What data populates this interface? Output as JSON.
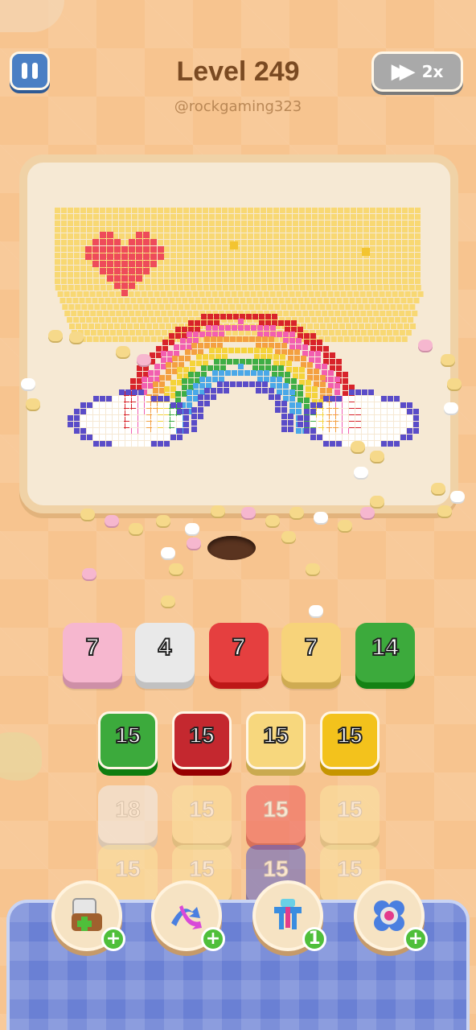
{
  "header": {
    "level_label": "Level 249",
    "username": "@rockgaming323",
    "speed_label": "2x"
  },
  "color_queue": [
    {
      "count": "7",
      "color": "#f6b7cf"
    },
    {
      "count": "4",
      "color": "#e9e9e9"
    },
    {
      "count": "7",
      "color": "#e53f3f"
    },
    {
      "count": "7",
      "color": "#f7d37a"
    },
    {
      "count": "14",
      "color": "#3caa3c"
    }
  ],
  "tile_grid": [
    [
      {
        "count": "15",
        "color": "#3caa3c",
        "state": "active"
      },
      {
        "count": "15",
        "color": "#c4282f",
        "state": "active"
      },
      {
        "count": "15",
        "color": "#f7d77d",
        "state": "active"
      },
      {
        "count": "15",
        "color": "#f3c21c",
        "state": "active"
      }
    ],
    [
      {
        "count": "18",
        "color": "#f0f0f0",
        "state": "faded"
      },
      {
        "count": "15",
        "color": "#fbe3a0",
        "state": "faded"
      },
      {
        "count": "15",
        "color": "#ee5b5b",
        "state": "faded"
      },
      {
        "count": "15",
        "color": "#fbe3a0",
        "state": "faded"
      }
    ],
    [
      {
        "count": "15",
        "color": "#fbe3a0",
        "state": "faded"
      },
      {
        "count": "15",
        "color": "#fbe3a0",
        "state": "faded"
      },
      {
        "count": "15",
        "color": "#5a5fc8",
        "state": "faded"
      },
      {
        "count": "15",
        "color": "#fbe3a0",
        "state": "faded"
      }
    ]
  ],
  "boosters": [
    {
      "name": "add-slot",
      "badge": "+"
    },
    {
      "name": "shuffle",
      "badge": "+"
    },
    {
      "name": "magnet",
      "badge": "1"
    },
    {
      "name": "flower",
      "badge": "+"
    }
  ],
  "colors": {
    "accent_blue": "#4a7fc4",
    "title_brown": "#7a4a22",
    "board_bg": "#f6e9d4"
  }
}
